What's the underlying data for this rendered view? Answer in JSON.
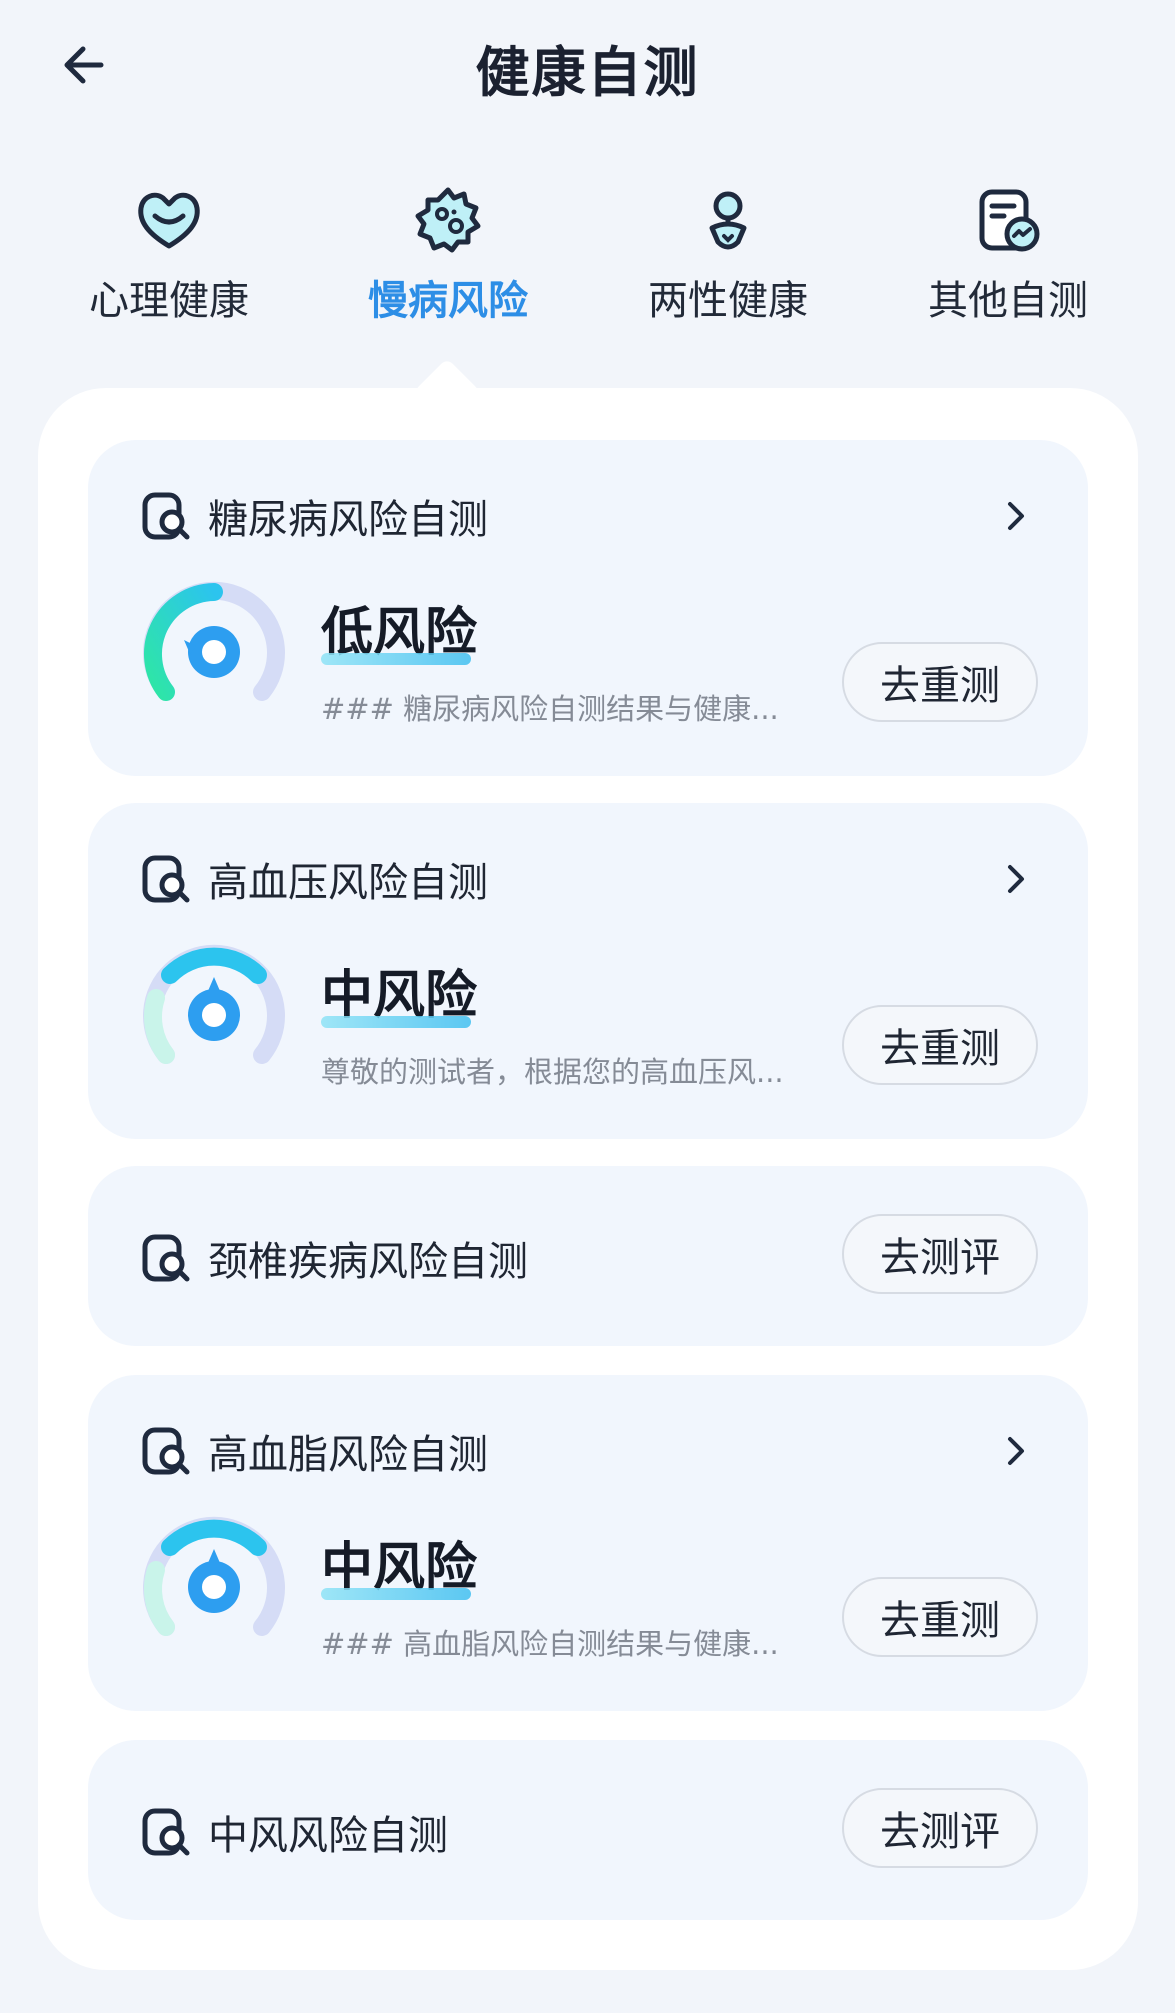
{
  "header": {
    "title": "健康自测"
  },
  "tabs": [
    {
      "label": "心理健康",
      "icon": "heart-icon"
    },
    {
      "label": "慢病风险",
      "icon": "virus-icon"
    },
    {
      "label": "两性健康",
      "icon": "gender-icon"
    },
    {
      "label": "其他自测",
      "icon": "report-icon"
    }
  ],
  "active_tab": "慢病风险",
  "colors": {
    "accent": "#2d8ee6",
    "low_risk": "#2ee6a6",
    "mid_risk": "#2cc4ee"
  },
  "cards": [
    {
      "title": "糖尿病风险自测",
      "risk": "低风险",
      "desc": "### 糖尿病风险自测结果与健康...",
      "button": "去重测"
    },
    {
      "title": "高血压风险自测",
      "risk": "中风险",
      "desc": "尊敬的测试者，根据您的高血压风...",
      "button": "去重测"
    },
    {
      "title": "颈椎疾病风险自测",
      "button": "去测评"
    },
    {
      "title": "高血脂风险自测",
      "risk": "中风险",
      "desc": "### 高血脂风险自测结果与健康...",
      "button": "去重测"
    },
    {
      "title": "中风风险自测",
      "button": "去测评"
    }
  ]
}
